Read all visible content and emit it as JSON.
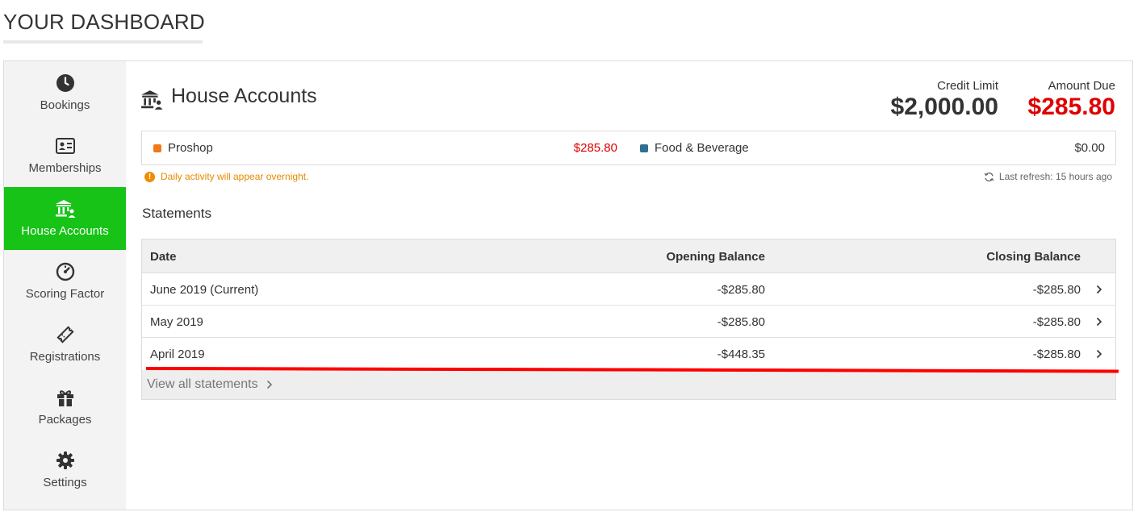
{
  "page": {
    "title": "YOUR DASHBOARD"
  },
  "sidebar": {
    "items": [
      {
        "label": "Bookings",
        "icon": "clock-icon"
      },
      {
        "label": "Memberships",
        "icon": "id-card-icon"
      },
      {
        "label": "House Accounts",
        "icon": "bank-user-icon",
        "active": true
      },
      {
        "label": "Scoring Factor",
        "icon": "gauge-icon"
      },
      {
        "label": "Registrations",
        "icon": "ticket-icon"
      },
      {
        "label": "Packages",
        "icon": "gift-icon"
      },
      {
        "label": "Settings",
        "icon": "gear-icon"
      }
    ]
  },
  "section": {
    "title": "House Accounts",
    "credit_limit_label": "Credit Limit",
    "credit_limit_value": "$2,000.00",
    "amount_due_label": "Amount Due",
    "amount_due_value": "$285.80"
  },
  "accounts": [
    {
      "name": "Proshop",
      "amount": "$285.80",
      "dot_color": "#f07a1a",
      "amount_color": "#e00000"
    },
    {
      "name": "Food & Beverage",
      "amount": "$0.00",
      "dot_color": "#2f6f8f",
      "amount_color": "#333333"
    }
  ],
  "notice": "Daily activity will appear overnight.",
  "refresh": "Last refresh: 15 hours ago",
  "statements": {
    "title": "Statements",
    "columns": [
      "Date",
      "Opening Balance",
      "Closing Balance"
    ],
    "rows": [
      {
        "date": "June 2019 (Current)",
        "opening": "-$285.80",
        "closing": "-$285.80"
      },
      {
        "date": "May 2019",
        "opening": "-$285.80",
        "closing": "-$285.80"
      },
      {
        "date": "April 2019",
        "opening": "-$448.35",
        "closing": "-$285.80"
      }
    ],
    "view_all": "View all statements"
  },
  "colors": {
    "active_green": "#16c316",
    "due_red": "#e00000",
    "annotation_red": "#ff0000",
    "notice_orange": "#e58a00"
  }
}
